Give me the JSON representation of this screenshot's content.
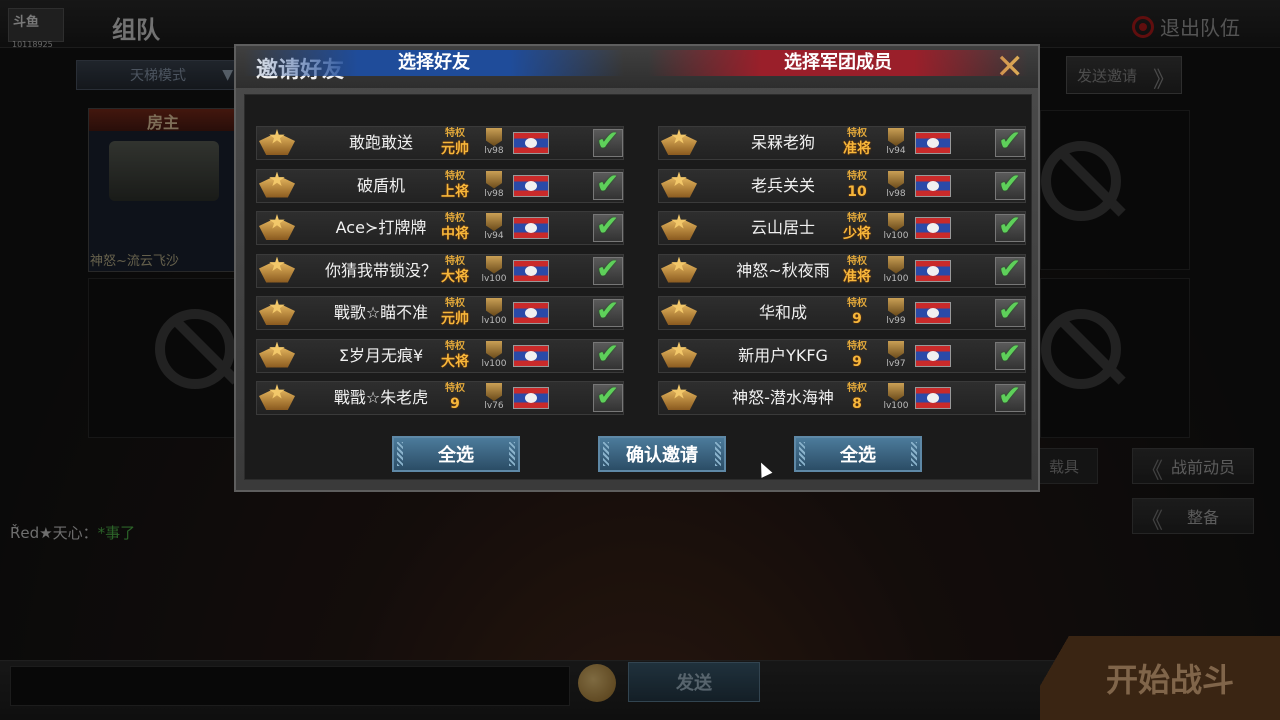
{
  "header": {
    "logo_text": "斗鱼",
    "logo_id": "10118925",
    "title": "组队",
    "quit_label": "退出队伍"
  },
  "toolbar": {
    "mode_label": "天梯模式",
    "send_invite_label": "发送邀请"
  },
  "team": {
    "host_tag": "房主",
    "host_name": "神怒~流云飞沙"
  },
  "side_buttons": {
    "vehicle": "载具",
    "pre_battle": "战前动员",
    "prepare": "整备"
  },
  "chat": {
    "sender": "Ř̌ed★天心：",
    "message": "*事了",
    "send_label": "发送"
  },
  "start_label": "开始战斗",
  "modal": {
    "title": "邀请好友",
    "left_header": "选择好友",
    "right_header": "选择军团成员",
    "select_all_left": "全选",
    "confirm": "确认邀请",
    "select_all_right": "全选",
    "friends": [
      {
        "name": "敢跑敢送",
        "priv": "特权",
        "rank": "元帅",
        "level": "lv98",
        "checked": true
      },
      {
        "name": "破盾机",
        "priv": "特权",
        "rank": "上将",
        "level": "lv98",
        "checked": true
      },
      {
        "name": "Ace≻打牌牌",
        "priv": "特权",
        "rank": "中将",
        "level": "lv94",
        "checked": true
      },
      {
        "name": "你猜我带锁没？",
        "priv": "特权",
        "rank": "大将",
        "level": "lv100",
        "checked": true
      },
      {
        "name": "戰歌☆瞄不准",
        "priv": "特权",
        "rank": "元帅",
        "level": "lv100",
        "checked": true
      },
      {
        "name": "Σ岁月无痕¥",
        "priv": "特权",
        "rank": "大将",
        "level": "lv100",
        "checked": true
      },
      {
        "name": "戰戬☆朱老虎",
        "priv": "特权",
        "rank": "9",
        "level": "lv76",
        "checked": true
      }
    ],
    "members": [
      {
        "name": "呆槑老狗",
        "priv": "特权",
        "rank": "准将",
        "level": "lv94",
        "checked": true
      },
      {
        "name": "老兵关关",
        "priv": "特权",
        "rank": "10",
        "level": "lv98",
        "checked": true
      },
      {
        "name": "云山居士",
        "priv": "特权",
        "rank": "少将",
        "level": "lv100",
        "checked": true
      },
      {
        "name": "神怒~秋夜雨",
        "priv": "特权",
        "rank": "准将",
        "level": "lv100",
        "checked": true
      },
      {
        "name": "华和成",
        "priv": "特权",
        "rank": "9",
        "level": "lv99",
        "checked": true
      },
      {
        "name": "新用户YKFG",
        "priv": "特权",
        "rank": "9",
        "level": "lv97",
        "checked": true
      },
      {
        "name": "神怒-潜水海神",
        "priv": "特权",
        "rank": "8",
        "level": "lv100",
        "checked": true
      }
    ]
  }
}
